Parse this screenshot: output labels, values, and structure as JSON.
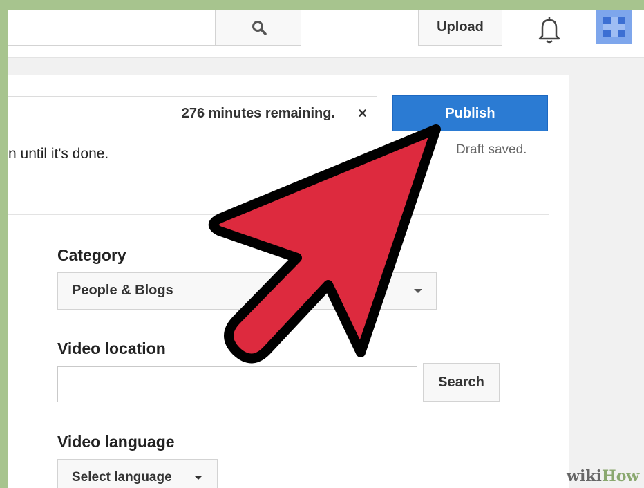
{
  "topbar": {
    "search_icon": "search-icon",
    "upload_label": "Upload",
    "bell_icon": "bell-icon"
  },
  "status": {
    "remaining_text": "276 minutes remaining.",
    "close_label": "×"
  },
  "publish_label": "Publish",
  "draft_text": "Draft saved.",
  "partial_text": "n until it's done.",
  "category": {
    "label": "Category",
    "value": "People & Blogs"
  },
  "location": {
    "label": "Video location",
    "value": "",
    "search_label": "Search"
  },
  "language": {
    "label": "Video language",
    "value": "Select language"
  },
  "watermark": {
    "wiki": "wiki",
    "how": "How"
  },
  "colors": {
    "publish_blue": "#2b7bd3",
    "arrow_red": "#dd2a3e",
    "frame_green": "#a7c48e"
  }
}
